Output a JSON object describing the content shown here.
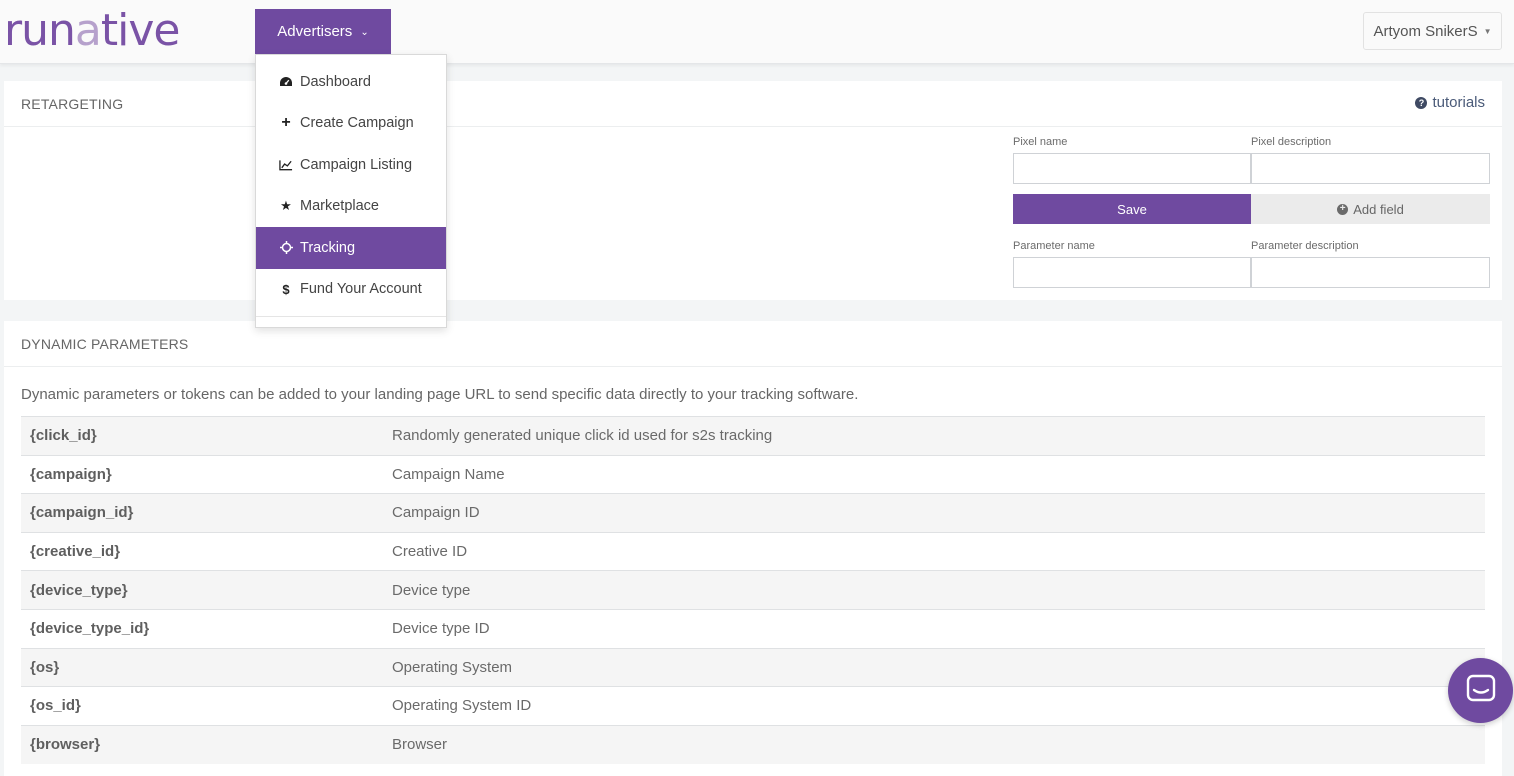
{
  "brand": {
    "logo_part1": "run",
    "logo_part2": "a",
    "logo_part3": "tive",
    "accent_color": "#6f4aa0"
  },
  "header": {
    "menu_button_label": "Advertisers",
    "user_name": "Artyom SnikerS"
  },
  "dropdown": {
    "items": [
      {
        "label": "Dashboard",
        "icon": "dashboard-icon"
      },
      {
        "label": "Create Campaign",
        "icon": "plus-icon"
      },
      {
        "label": "Campaign Listing",
        "icon": "line-chart-icon"
      },
      {
        "label": "Marketplace",
        "icon": "star-icon"
      },
      {
        "label": "Tracking",
        "icon": "crosshairs-icon",
        "active": true
      },
      {
        "label": "Fund Your Account",
        "icon": "dollar-icon"
      }
    ]
  },
  "retargeting": {
    "title": "RETARGETING",
    "tutorials_label": "tutorials",
    "pixel_name_label": "Pixel name",
    "pixel_name_value": "",
    "pixel_description_label": "Pixel description",
    "pixel_description_value": "",
    "save_label": "Save",
    "add_field_label": "Add field",
    "parameter_name_label": "Parameter name",
    "parameter_name_value": "",
    "parameter_description_label": "Parameter description",
    "parameter_description_value": ""
  },
  "dynamic": {
    "title": "DYNAMIC PARAMETERS",
    "description": "Dynamic parameters or tokens can be added to your landing page URL to send specific data directly to your tracking software.",
    "rows": [
      {
        "token": "{click_id}",
        "desc": "Randomly generated unique click id used for s2s tracking"
      },
      {
        "token": "{campaign}",
        "desc": "Campaign Name"
      },
      {
        "token": "{campaign_id}",
        "desc": "Campaign ID"
      },
      {
        "token": "{creative_id}",
        "desc": "Creative ID"
      },
      {
        "token": "{device_type}",
        "desc": "Device type"
      },
      {
        "token": "{device_type_id}",
        "desc": "Device type ID"
      },
      {
        "token": "{os}",
        "desc": "Operating System"
      },
      {
        "token": "{os_id}",
        "desc": "Operating System ID"
      },
      {
        "token": "{browser}",
        "desc": "Browser"
      }
    ]
  },
  "chat": {
    "icon": "chat-icon"
  }
}
